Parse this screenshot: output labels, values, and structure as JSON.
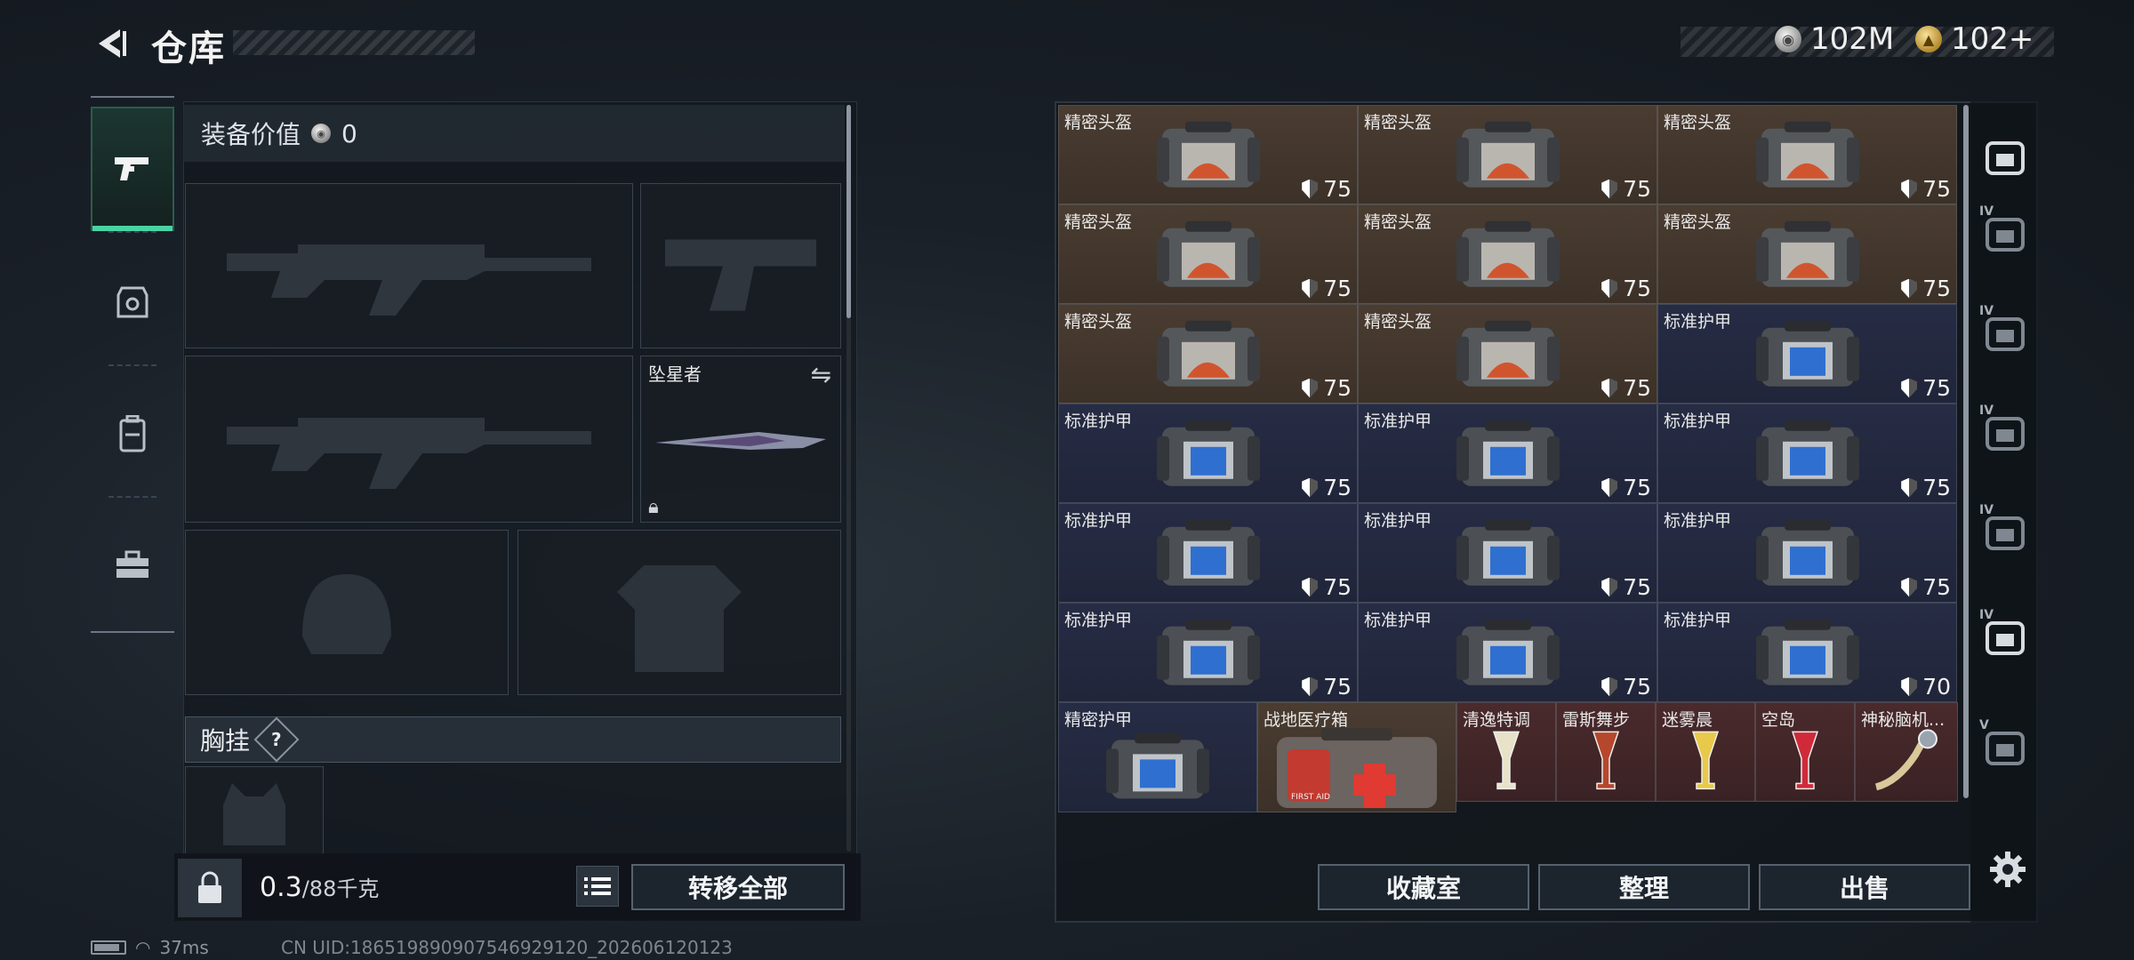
{
  "header": {
    "title": "仓库",
    "currencies": [
      {
        "icon": "silver-coin-icon",
        "value": "102M"
      },
      {
        "icon": "gold-coin-icon",
        "value": "102+"
      }
    ]
  },
  "rail": {
    "items": [
      {
        "icon": "pistol-icon",
        "active": true
      },
      {
        "icon": "armor-icon",
        "active": false
      },
      {
        "icon": "backpack-icon",
        "active": false
      },
      {
        "icon": "toolbox-icon",
        "active": false
      }
    ]
  },
  "equipment": {
    "value_label": "装备价值",
    "value": "0",
    "melee_name": "坠星者",
    "chest_rig_label": "胸挂",
    "chest_rig_help": "?",
    "weight_current": "0.3",
    "weight_max": "/88千克",
    "transfer_all_label": "转移全部"
  },
  "storage": {
    "items": [
      {
        "name": "精密头盔",
        "durability": "75",
        "type": "helmet"
      },
      {
        "name": "精密头盔",
        "durability": "75",
        "type": "helmet"
      },
      {
        "name": "精密头盔",
        "durability": "75",
        "type": "helmet"
      },
      {
        "name": "精密头盔",
        "durability": "75",
        "type": "helmet"
      },
      {
        "name": "精密头盔",
        "durability": "75",
        "type": "helmet"
      },
      {
        "name": "精密头盔",
        "durability": "75",
        "type": "helmet"
      },
      {
        "name": "精密头盔",
        "durability": "75",
        "type": "helmet"
      },
      {
        "name": "精密头盔",
        "durability": "75",
        "type": "helmet"
      },
      {
        "name": "标准护甲",
        "durability": "75",
        "type": "armor"
      },
      {
        "name": "标准护甲",
        "durability": "75",
        "type": "armor"
      },
      {
        "name": "标准护甲",
        "durability": "75",
        "type": "armor"
      },
      {
        "name": "标准护甲",
        "durability": "75",
        "type": "armor"
      },
      {
        "name": "标准护甲",
        "durability": "75",
        "type": "armor"
      },
      {
        "name": "标准护甲",
        "durability": "75",
        "type": "armor"
      },
      {
        "name": "标准护甲",
        "durability": "75",
        "type": "armor"
      },
      {
        "name": "标准护甲",
        "durability": "75",
        "type": "armor"
      },
      {
        "name": "标准护甲",
        "durability": "75",
        "type": "armor"
      },
      {
        "name": "标准护甲",
        "durability": "70",
        "type": "armor"
      }
    ],
    "bottom_items": [
      {
        "name": "精密护甲",
        "type": "armor-large"
      },
      {
        "name": "战地医疗箱",
        "type": "medkit"
      },
      {
        "name": "清逸特调",
        "type": "drink"
      },
      {
        "name": "雷斯舞步",
        "type": "drink"
      },
      {
        "name": "迷雾晨",
        "type": "drink"
      },
      {
        "name": "空岛",
        "type": "drink"
      },
      {
        "name": "神秘脑机...",
        "type": "artifact"
      }
    ],
    "medkit_text": "FIRST AID",
    "buttons": {
      "collection": "收藏室",
      "organize": "整理",
      "sell": "出售"
    }
  },
  "side_filters": [
    {
      "icon": "helmet-filter-icon",
      "tier": ""
    },
    {
      "icon": "armor-filter-icon",
      "tier": "IV"
    },
    {
      "icon": "rig-filter-icon",
      "tier": "IV"
    },
    {
      "icon": "backpack-filter-icon",
      "tier": "IV"
    },
    {
      "icon": "folder-filter-icon",
      "tier": "IV"
    },
    {
      "icon": "medkit-filter-icon",
      "tier": "IV"
    },
    {
      "icon": "card-filter-icon",
      "tier": "V"
    }
  ],
  "status": {
    "ping": "37ms",
    "uid": "CN UID:1865198909075469291​20_202606120123"
  }
}
